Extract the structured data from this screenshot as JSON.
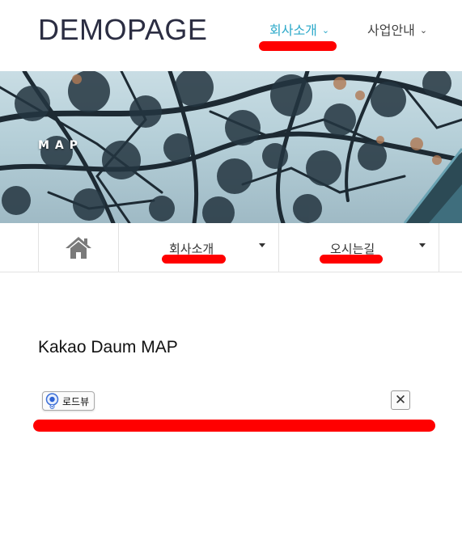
{
  "header": {
    "logo": "DEMOPAGE",
    "nav": [
      {
        "label": "회사소개",
        "active": true
      },
      {
        "label": "사업안내",
        "active": false
      }
    ],
    "chevron": "⌄"
  },
  "hero": {
    "title": "MAP"
  },
  "subnav": {
    "home_icon": "home-icon",
    "items": [
      {
        "label": "회사소개"
      },
      {
        "label": "오시는길"
      }
    ]
  },
  "map": {
    "title": "Kakao Daum MAP",
    "roadview_label": "로드뷰",
    "close_symbol": "✕"
  },
  "colors": {
    "accent": "#2aa8c9",
    "annotation": "#ff0000"
  }
}
